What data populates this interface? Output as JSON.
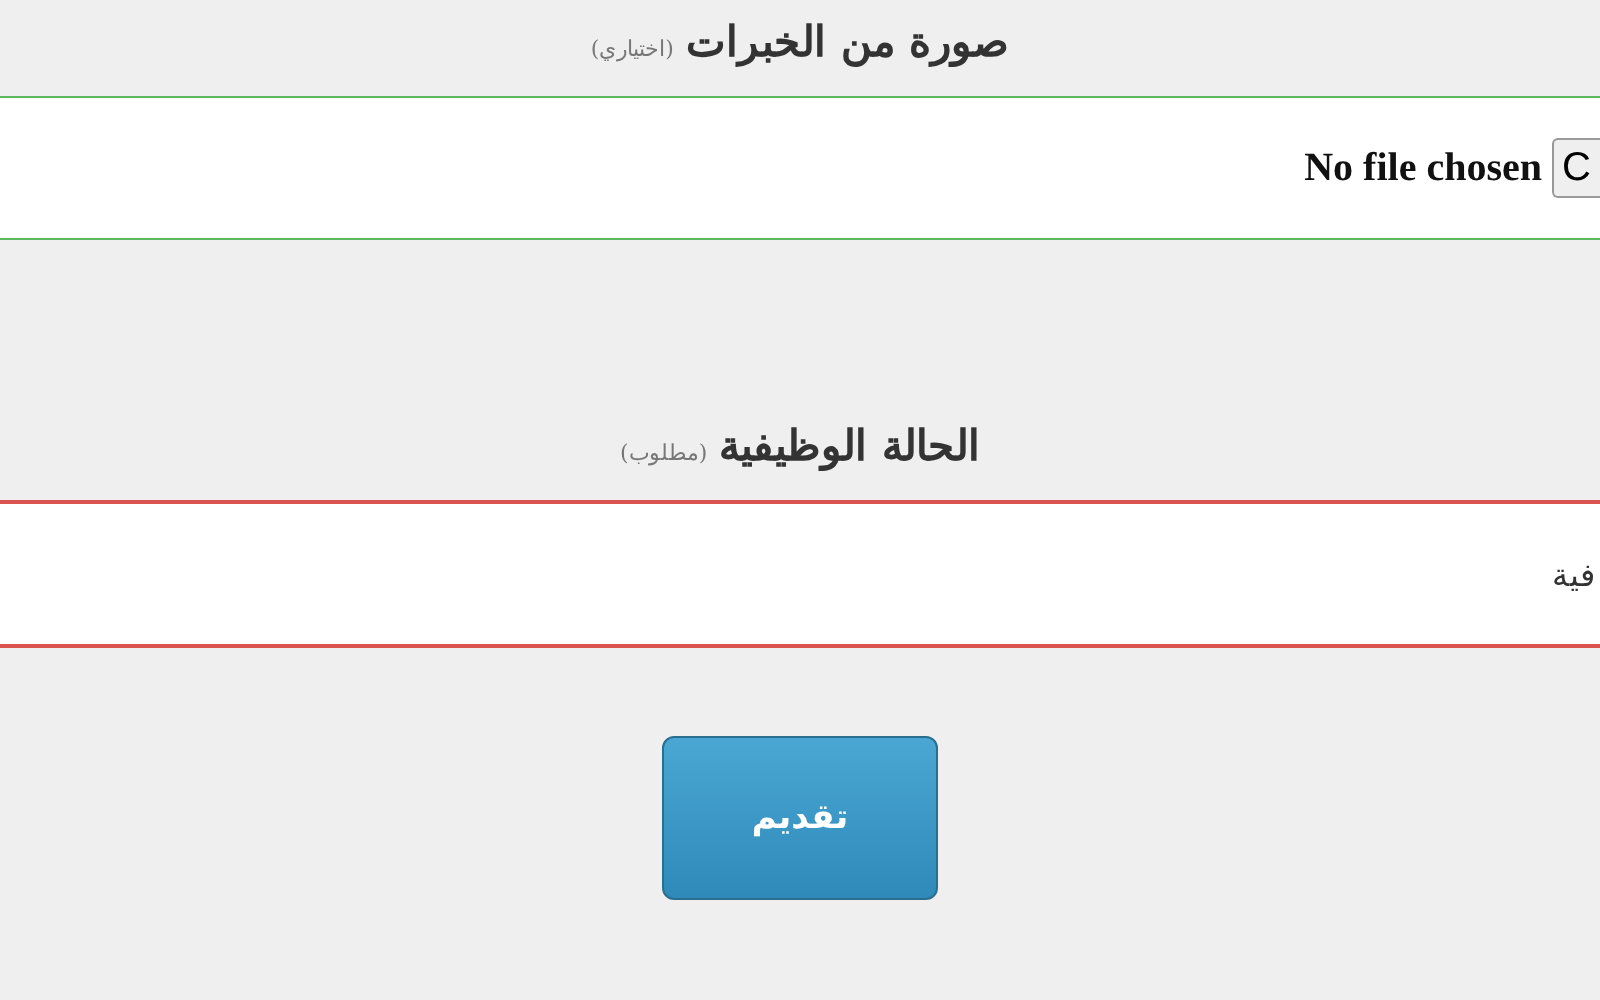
{
  "fields": [
    {
      "kind": "file",
      "label": "صورة من الخبرات",
      "note": "(اختياري)",
      "valid": true,
      "status_text": "No file chosen",
      "button": "C"
    },
    {
      "kind": "select",
      "label": "الحالة الوظيفية",
      "note": "(مطلوب)",
      "valid": false,
      "value": "فية"
    }
  ],
  "submit": "تقديم"
}
